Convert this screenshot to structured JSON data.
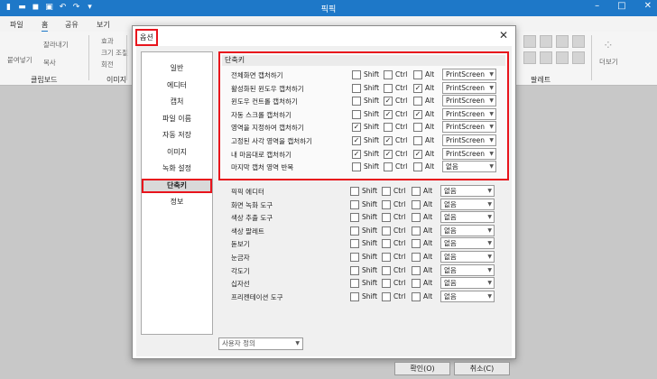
{
  "app": {
    "title": "픽픽",
    "menu": [
      "파일",
      "홈",
      "공유",
      "보기"
    ],
    "ribbon_items": [
      "잘라내기",
      "붙여넣기",
      "복사",
      "효과",
      "크기 조절",
      "회전"
    ],
    "ribbon_groups": [
      "클립보드",
      "이미지",
      "팔레트"
    ],
    "more_label": "더보기"
  },
  "dialog": {
    "title": "옵션",
    "close": "✕",
    "sidebar": [
      "일반",
      "에디터",
      "캡처",
      "파일 이름",
      "자동 저장",
      "이미지",
      "녹화 설정",
      "단축키",
      "정보"
    ],
    "selected_index": 7,
    "section_title": "단축키",
    "modifier_labels": {
      "shift": "Shift",
      "ctrl": "Ctrl",
      "alt": "Alt"
    },
    "shortcuts": [
      {
        "name": "전체화면 캡처하기",
        "shift": false,
        "ctrl": false,
        "alt": false,
        "key": "PrintScreen"
      },
      {
        "name": "활성화된 윈도우 캡처하기",
        "shift": false,
        "ctrl": false,
        "alt": true,
        "key": "PrintScreen"
      },
      {
        "name": "윈도우 컨트롤 캡처하기",
        "shift": false,
        "ctrl": true,
        "alt": false,
        "key": "PrintScreen"
      },
      {
        "name": "자동 스크롤 캡처하기",
        "shift": false,
        "ctrl": true,
        "alt": true,
        "key": "PrintScreen"
      },
      {
        "name": "영역을 지정하여 캡처하기",
        "shift": true,
        "ctrl": false,
        "alt": false,
        "key": "PrintScreen"
      },
      {
        "name": "고정된 사각 영역을 캡처하기",
        "shift": true,
        "ctrl": true,
        "alt": false,
        "key": "PrintScreen"
      },
      {
        "name": "내 마음대로 캡처하기",
        "shift": true,
        "ctrl": true,
        "alt": true,
        "key": "PrintScreen"
      },
      {
        "name": "마지막 캡처 영역 반복",
        "shift": false,
        "ctrl": false,
        "alt": false,
        "key": "없음"
      }
    ],
    "tools": [
      {
        "name": "픽픽 에디터",
        "key": "없음"
      },
      {
        "name": "화면 녹화 도구",
        "key": "없음"
      },
      {
        "name": "색상 추출 도구",
        "key": "없음"
      },
      {
        "name": "색상 팔레트",
        "key": "없음"
      },
      {
        "name": "돋보기",
        "key": "없음"
      },
      {
        "name": "눈금자",
        "key": "없음"
      },
      {
        "name": "각도기",
        "key": "없음"
      },
      {
        "name": "십자선",
        "key": "없음"
      },
      {
        "name": "프리젠테이션 도구",
        "key": "없음"
      }
    ],
    "custom_select": "사용자 정의",
    "ok_button": "확인(O)",
    "cancel_button": "취소(C)"
  }
}
